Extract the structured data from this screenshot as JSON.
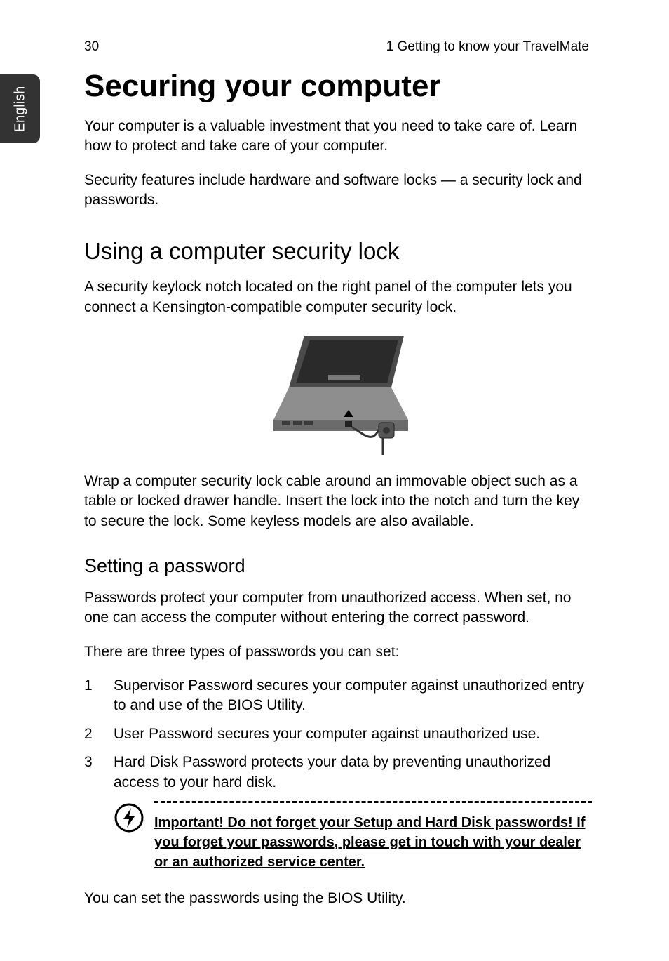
{
  "lang_tab": "English",
  "header": {
    "page_number": "30",
    "running_head": "1 Getting to know your TravelMate"
  },
  "h1": "Securing your computer",
  "intro_p1": "Your computer is a valuable investment that you need to take care of. Learn how to protect and take care of your computer.",
  "intro_p2": "Security features include hardware and software locks — a security lock and passwords.",
  "h2": "Using a computer security lock",
  "seclock_p1": "A security keylock notch located on the right panel of the computer lets you connect a Kensington-compatible computer security lock.",
  "figure_alt": "laptop-security-lock-illustration",
  "seclock_p2": "Wrap a computer security lock cable around an immovable object such as a table or locked drawer handle. Insert the lock into the notch and turn the key to secure the lock. Some keyless models are also available.",
  "h3": "Setting a password",
  "pw_p1": "Passwords protect your computer from unauthorized access. When set, no one can access the computer without entering the correct password.",
  "pw_p2": "There are three types of passwords you can set:",
  "pw_list": {
    "0": "Supervisor Password secures your computer against unauthorized entry to and use of the BIOS Utility.",
    "1": "User Password secures your computer against unauthorized use.",
    "2": "Hard Disk Password protects your data by preventing unauthorized access to your hard disk."
  },
  "note_text": "Important! Do not forget your Setup and Hard Disk passwords! If you forget your passwords, please get in touch with your dealer or an authorized service center.",
  "closing": "You can set the passwords using the BIOS Utility."
}
